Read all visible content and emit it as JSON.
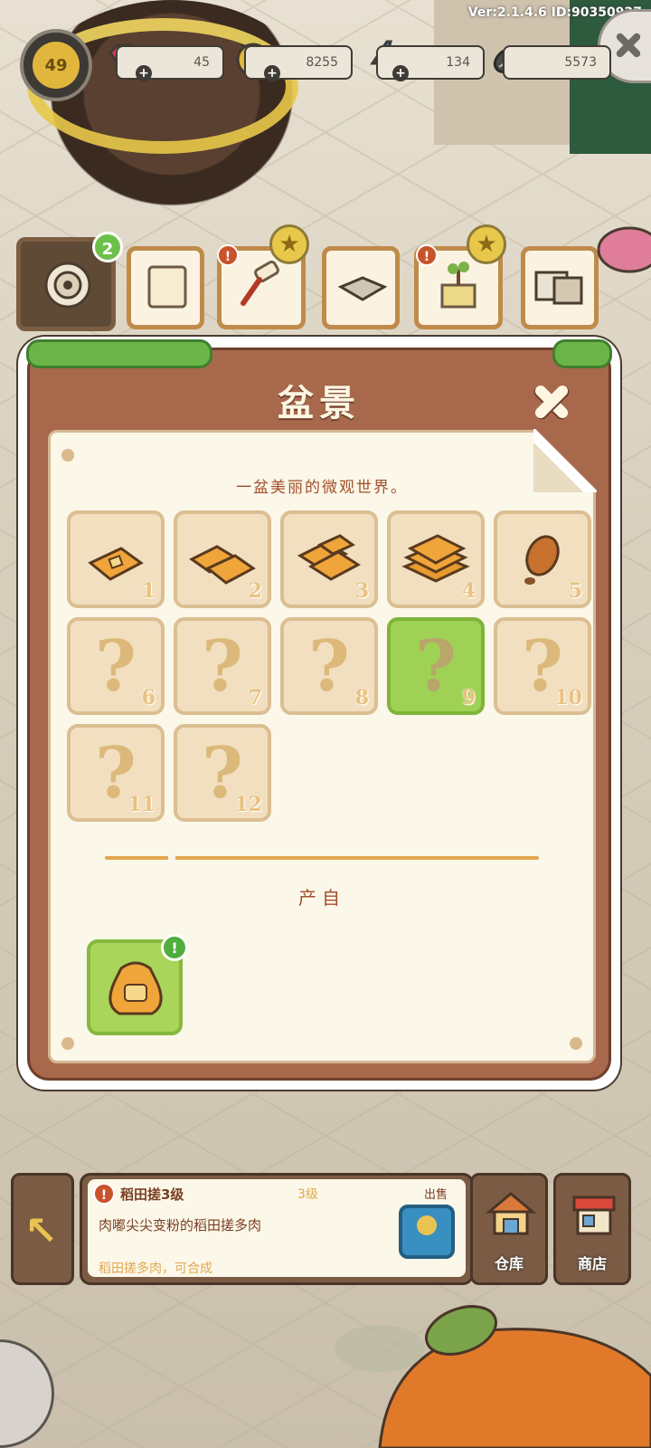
{
  "version_text": "Ver:2.1.4.6 ID:90350927",
  "hud": {
    "level": "49",
    "gems": "45",
    "coins": "8255",
    "energy": "134",
    "seeds": "5573"
  },
  "shelf": {
    "first_slot_badge": "2",
    "info_badge": "!"
  },
  "modal": {
    "title": "盆景",
    "description": "一盆美丽的微观世界。",
    "produce_label": "产自",
    "items": [
      {
        "num": "1",
        "unlocked": true,
        "icon": "seed-bag-1-icon"
      },
      {
        "num": "2",
        "unlocked": true,
        "icon": "seed-bag-2-icon"
      },
      {
        "num": "3",
        "unlocked": true,
        "icon": "seed-bag-3-icon"
      },
      {
        "num": "4",
        "unlocked": true,
        "icon": "seed-bag-4-icon"
      },
      {
        "num": "5",
        "unlocked": true,
        "icon": "pinecone-icon"
      },
      {
        "num": "6",
        "unlocked": false
      },
      {
        "num": "7",
        "unlocked": false
      },
      {
        "num": "8",
        "unlocked": false
      },
      {
        "num": "9",
        "unlocked": false,
        "highlighted": true
      },
      {
        "num": "10",
        "unlocked": false
      },
      {
        "num": "11",
        "unlocked": false
      },
      {
        "num": "12",
        "unlocked": false
      }
    ],
    "locked_mark": "?",
    "produce_badge": "!"
  },
  "bottom": {
    "info_title": "稻田搓3级",
    "info_level": "3级",
    "info_out": "出售",
    "info_desc": "肉嘟尖尖变粉的稻田搓多肉",
    "info_hint": "稻田搓多肉，可合成",
    "warehouse_label": "仓库",
    "shop_label": "商店"
  },
  "colors": {
    "modal_brown": "#a8684c",
    "paper": "#fbf7e9",
    "cell": "#f1dfc0",
    "highlight_green": "#9fd155",
    "text_brown": "#a24f2a"
  }
}
